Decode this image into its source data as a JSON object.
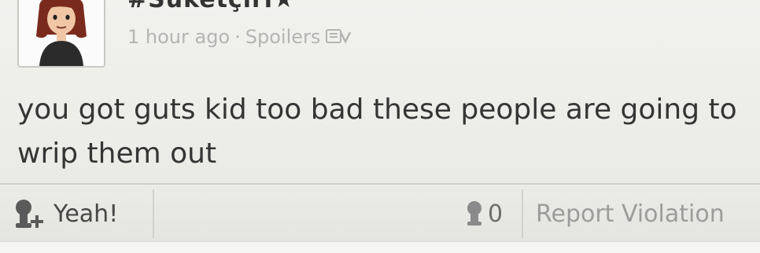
{
  "post": {
    "username": "#Suketçiri★",
    "time": "1 hour ago",
    "separator": "·",
    "tag": "Spoilers",
    "text": "you got guts kid too bad these people are going to wrip them out"
  },
  "actions": {
    "yeah_label": "Yeah!",
    "yeah_count": "0",
    "report_label": "Report Violation"
  },
  "icons": {
    "avatar": "mii-avatar",
    "spoiler": "spoiler-icon",
    "yeah": "yeah-add-icon",
    "yeah_count": "yeah-count-icon"
  }
}
